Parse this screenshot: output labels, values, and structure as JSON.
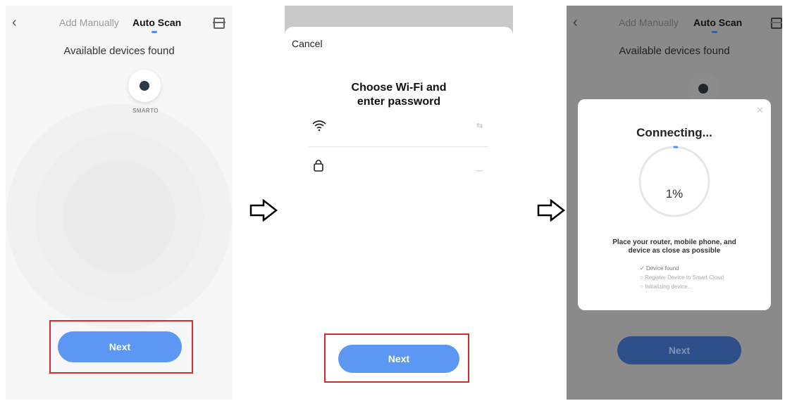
{
  "panel1": {
    "tabs": {
      "manual": "Add Manually",
      "auto": "Auto Scan"
    },
    "title": "Available devices found",
    "device": {
      "name": "SMARTO"
    },
    "next_label": "Next"
  },
  "panel2": {
    "cancel_label": "Cancel",
    "title_line1": "Choose Wi-Fi and",
    "title_line2": "enter password",
    "next_label": "Next"
  },
  "panel3": {
    "tabs": {
      "manual": "Add Manually",
      "auto": "Auto Scan"
    },
    "title": "Available devices found",
    "dialog": {
      "title": "Connecting...",
      "progress_text": "1%",
      "progress_value": 0.01,
      "tip_line1": "Place your router, mobile phone, and",
      "tip_line2": "device as close as possible",
      "steps": [
        {
          "label": "Device found",
          "status": "done"
        },
        {
          "label": "Register Device to Smart Cloud",
          "status": "pending"
        },
        {
          "label": "Initializing device...",
          "status": "pending"
        }
      ]
    },
    "next_label": "Next"
  },
  "colors": {
    "accent": "#5b97f3",
    "highlight": "#d92b2b"
  },
  "icons": [
    "back-arrow-icon",
    "scan-icon",
    "wifi-icon",
    "switch-network-icon",
    "lock-icon",
    "eye-hidden-icon",
    "close-icon",
    "check-icon",
    "right-arrow-icon"
  ]
}
